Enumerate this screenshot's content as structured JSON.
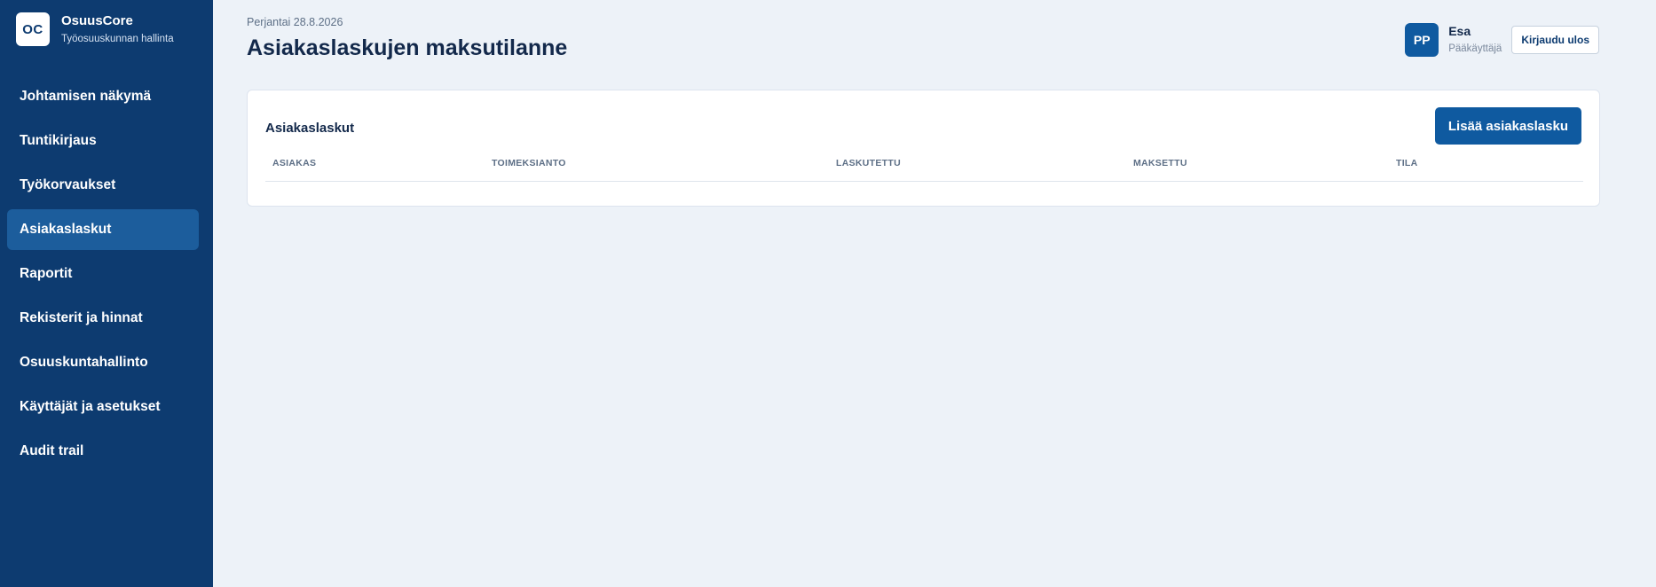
{
  "sidebar": {
    "logo_text": "OC",
    "brand_name": "OsuusCore",
    "brand_subtitle": "Työosuuskunnan hallinta",
    "items": [
      {
        "label": "Johtamisen näkymä"
      },
      {
        "label": "Tuntikirjaus"
      },
      {
        "label": "Työkorvaukset"
      },
      {
        "label": "Asiakaslaskut",
        "active": true
      },
      {
        "label": "Raportit"
      },
      {
        "label": "Rekisterit ja hinnat"
      },
      {
        "label": "Osuuskuntahallinto"
      },
      {
        "label": "Käyttäjät ja asetukset"
      },
      {
        "label": "Audit trail"
      }
    ]
  },
  "header": {
    "date": "Perjantai 28.8.2026",
    "title": "Asiakaslaskujen maksutilanne",
    "user": {
      "initials": "PP",
      "name": "Esa",
      "role": "Pääkäyttäjä"
    },
    "logout_label": "Kirjaudu ulos"
  },
  "card": {
    "title": "Asiakaslaskut",
    "add_button_label": "Lisää asiakaslasku",
    "columns": [
      "ASIAKAS",
      "TOIMEKSIANTO",
      "LASKUTETTU",
      "MAKSETTU",
      "TILA"
    ],
    "rows": []
  },
  "colors": {
    "sidebar_bg": "#0d3b70",
    "sidebar_active": "#1c5d9c",
    "primary": "#0f5aa0",
    "page_bg": "#edf2f8"
  }
}
